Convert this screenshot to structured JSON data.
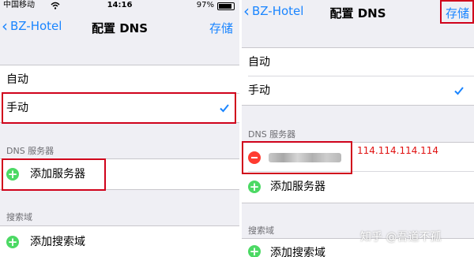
{
  "left": {
    "status": {
      "carrier": "中国移动",
      "time": "14:16",
      "battery": "97%"
    },
    "nav": {
      "back_label": "BZ-Hotel",
      "title": "配置 DNS",
      "save_label": "存储"
    },
    "options": [
      {
        "label": "自动"
      },
      {
        "label": "手动",
        "checked": true
      }
    ],
    "dns_header": "DNS 服务器",
    "add_server_label": "添加服务器",
    "search_header": "搜索域",
    "add_search_label": "添加搜索域"
  },
  "right": {
    "nav": {
      "back_label": "BZ-Hotel",
      "title": "配置 DNS",
      "save_label": "存储"
    },
    "options": [
      {
        "label": "自动"
      },
      {
        "label": "手动",
        "checked": true
      }
    ],
    "dns_header": "DNS 服务器",
    "dns_annotation": "114.114.114.114",
    "add_server_label": "添加服务器",
    "search_header": "搜索域",
    "add_search_label": "添加搜索域"
  },
  "watermark": "知乎 @吾道不孤",
  "colors": {
    "accent": "#1a85ff",
    "highlight": "#d0021b",
    "add": "#4cd964",
    "delete": "#ff3b30"
  }
}
